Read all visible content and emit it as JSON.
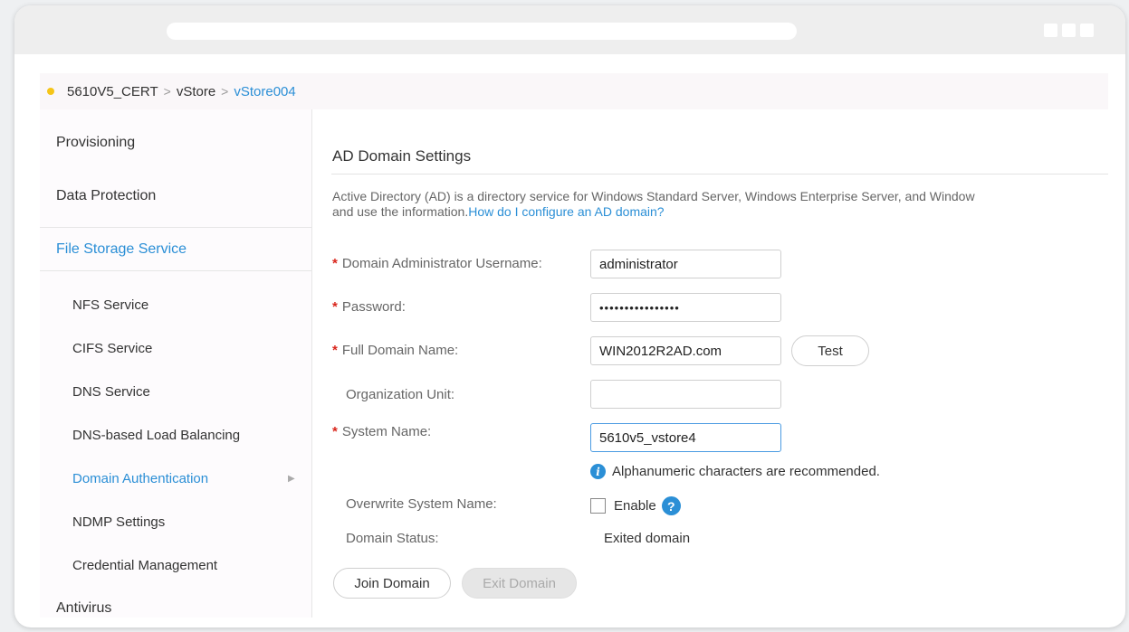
{
  "breadcrumb": {
    "device": "5610V5_CERT",
    "level2": "vStore",
    "current": "vStore004",
    "separator": ">"
  },
  "sidebar": {
    "groups": {
      "provisioning": "Provisioning",
      "data_protection": "Data Protection",
      "file_storage": "File Storage Service",
      "antivirus": "Antivirus"
    },
    "items": [
      "NFS Service",
      "CIFS Service",
      "DNS Service",
      "DNS-based Load Balancing",
      "Domain Authentication",
      "NDMP Settings",
      "Credential Management"
    ],
    "arrow": "▶"
  },
  "main": {
    "title": "AD Domain Settings",
    "description_line1": "Active Directory (AD) is a directory service for Windows Standard Server, Windows Enterprise Server, and Window",
    "description_line2": "and use the information.",
    "help_link": "How do I configure an AD domain?",
    "fields": {
      "username": {
        "label": "Domain Administrator Username:",
        "value": "administrator"
      },
      "password": {
        "label": "Password:",
        "value": "••••••••••••••••"
      },
      "domain": {
        "label": "Full Domain Name:",
        "value": "WIN2012R2AD.com"
      },
      "ou": {
        "label": "Organization Unit:",
        "value": ""
      },
      "system_name": {
        "label": "System Name:",
        "value": "5610v5_vstore4"
      }
    },
    "required_mark": "*",
    "test_button": "Test",
    "hint": "Alphanumeric characters are recommended.",
    "info_icon_glyph": "i",
    "overwrite": {
      "label": "Overwrite System Name:",
      "checkbox_label": "Enable",
      "help_glyph": "?"
    },
    "status": {
      "label": "Domain Status:",
      "value": "Exited domain"
    },
    "join_button": "Join Domain",
    "exit_button": "Exit Domain"
  },
  "colors": {
    "accent": "#2b8fd6",
    "required": "#d9261c",
    "status_dot": "#f5c518"
  }
}
